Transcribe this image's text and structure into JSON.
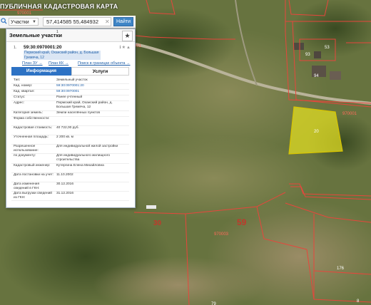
{
  "app": {
    "title": "ПУБЛИЧНАЯ КАДАСТРОВАЯ КАРТА"
  },
  "search": {
    "type_label": "Участки",
    "query": "57,414585 55,484932",
    "button_label": "Найти"
  },
  "panel": {
    "title": "Земельные участки",
    "count": "1"
  },
  "result": {
    "index": "1.",
    "cad_number": "59:30:0970001:20",
    "address": "Пермский край, Оханский район, д. Большая Гремяча, 12",
    "links": [
      "План ЗУ →",
      "План КК →",
      "Поиск в границах объекта →"
    ],
    "tabs": [
      "Информация",
      "Услуги"
    ]
  },
  "attributes": [
    {
      "key": "Тип:",
      "value": "Земельный участок",
      "link": false
    },
    {
      "key": "Кад. номер:",
      "value": "59:30:0970001:20",
      "link": true
    },
    {
      "key": "Кад. квартал:",
      "value": "59:30:0970001",
      "link": true
    },
    {
      "key": "Статус:",
      "value": "Ранее учтенный",
      "link": false
    },
    {
      "key": "Адрес:",
      "value": "Пермский край, Оханский район, д. Большая Гремяча, 12",
      "link": false
    },
    {
      "key": "Категория земель:",
      "value": "Земли населённых пунктов",
      "link": false
    },
    {
      "key": "Форма собственности:",
      "value": "",
      "link": false
    },
    {
      "key": "Кадастровая стоимость:",
      "value": "40 722,00 руб.",
      "link": false
    },
    {
      "key": "Уточненная площадь:",
      "value": "2 200 кв. м",
      "link": false
    },
    {
      "key": "Разрешенное использование:",
      "value": "Для индивидуальной жилой застройки",
      "link": false
    },
    {
      "key": "по документу:",
      "value": "Для индивидуального жилищного строительства",
      "link": false
    },
    {
      "key": "Кадастровый инженер:",
      "value": "Кутергина Елена Михайловна",
      "link": false
    },
    {
      "key": "Дата постановки на учет:",
      "value": "11.10.2002",
      "link": false
    },
    {
      "key": "Дата изменения сведений в ГКН:",
      "value": "30.12.2016",
      "link": false
    },
    {
      "key": "Дата выгрузки сведений из ГКН:",
      "value": "31.12.2016",
      "link": false
    }
  ],
  "map_labels": {
    "quarter_top": "970001",
    "quarter_right": "970001",
    "quarter_bottom": "970003",
    "quarter_left_edge": "970001",
    "region_left": "30",
    "region_big": "59",
    "parcel_highlight": "20",
    "parcel_93": "93",
    "parcel_94": "94",
    "parcel_53": "53",
    "parcel_176": "176",
    "parcel_bottom_a": "79",
    "parcel_bottom_b": "8"
  },
  "colors": {
    "boundary": "#e8463c",
    "highlight_fill": "#e4e021",
    "accent": "#2d72c4",
    "link": "#1f5fa8"
  }
}
